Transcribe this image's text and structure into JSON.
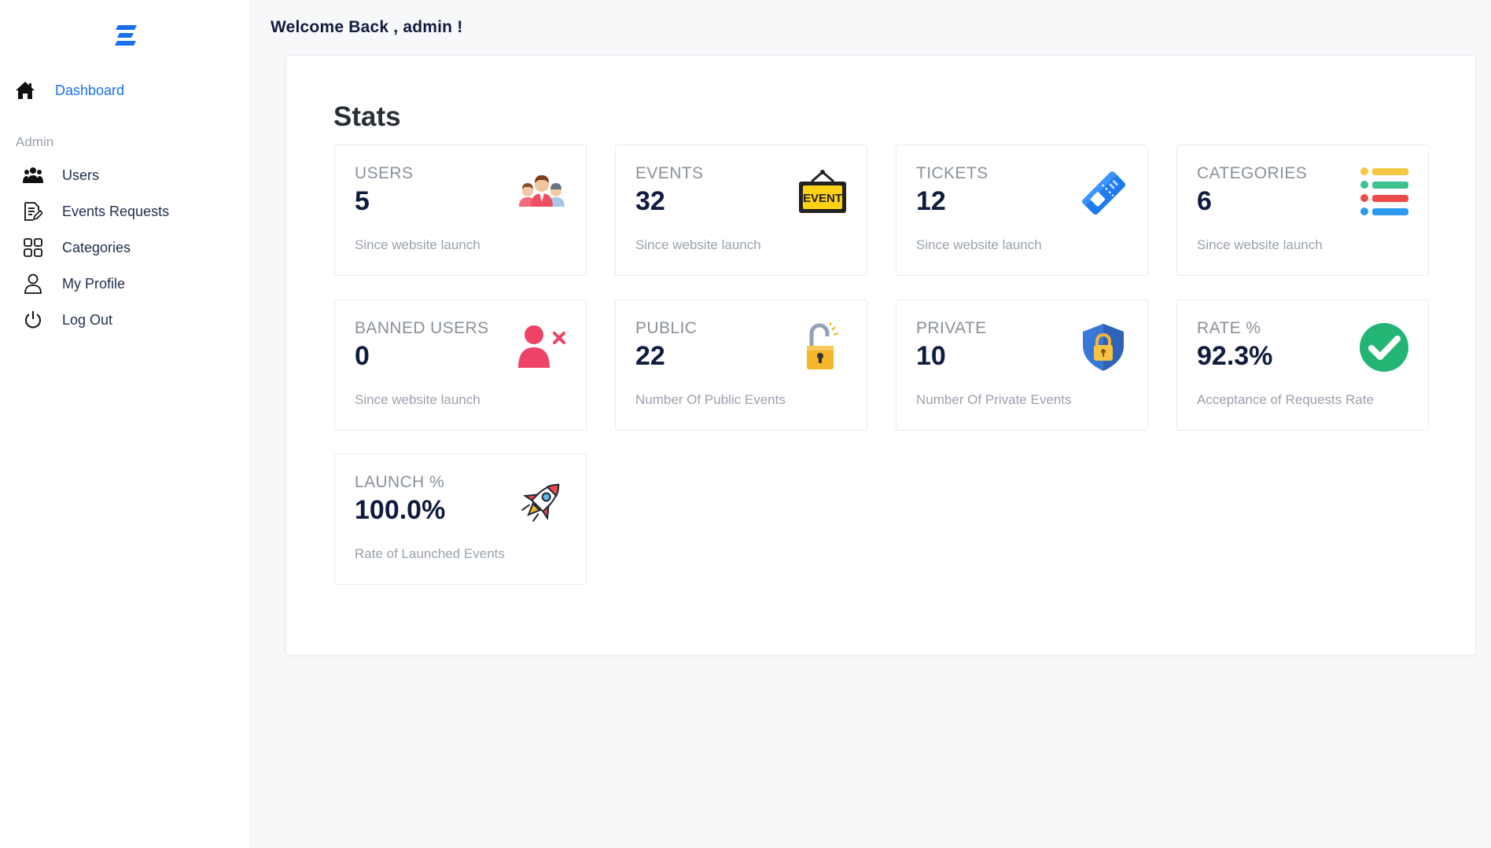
{
  "sidebar": {
    "dashboard_label": "Dashboard",
    "section_label": "Admin",
    "items": [
      {
        "label": "Users",
        "icon": "users-icon"
      },
      {
        "label": "Events Requests",
        "icon": "edit-document-icon"
      },
      {
        "label": "Categories",
        "icon": "grid-icon"
      },
      {
        "label": "My Profile",
        "icon": "user-icon"
      },
      {
        "label": "Log Out",
        "icon": "power-icon"
      }
    ]
  },
  "header": {
    "welcome": "Welcome Back , admin !"
  },
  "stats": {
    "title": "Stats",
    "cards": [
      {
        "label": "USERS",
        "value": "5",
        "sub": "Since website launch",
        "icon": "group-people-icon"
      },
      {
        "label": "EVENTS",
        "value": "32",
        "sub": "Since website launch",
        "icon": "event-sign-icon"
      },
      {
        "label": "TICKETS",
        "value": "12",
        "sub": "Since website launch",
        "icon": "ticket-icon"
      },
      {
        "label": "CATEGORIES",
        "value": "6",
        "sub": "Since website launch",
        "icon": "color-list-icon"
      },
      {
        "label": "BANNED USERS",
        "value": "0",
        "sub": "Since website launch",
        "icon": "banned-user-icon"
      },
      {
        "label": "PUBLIC",
        "value": "22",
        "sub": "Number Of Public Events",
        "icon": "unlocked-padlock-icon"
      },
      {
        "label": "PRIVATE",
        "value": "10",
        "sub": "Number Of Private Events",
        "icon": "shield-lock-icon"
      },
      {
        "label": "RATE %",
        "value": "92.3%",
        "sub": "Acceptance of Requests Rate",
        "icon": "check-circle-icon"
      },
      {
        "label": "LAUNCH %",
        "value": "100.0%",
        "sub": "Rate of Launched Events",
        "icon": "rocket-icon"
      }
    ],
    "event_sign_text": "EVENT"
  },
  "colors": {
    "accent": "#1a6ef0",
    "title_dark": "#0f1c3f",
    "muted": "#9aa1ad"
  }
}
